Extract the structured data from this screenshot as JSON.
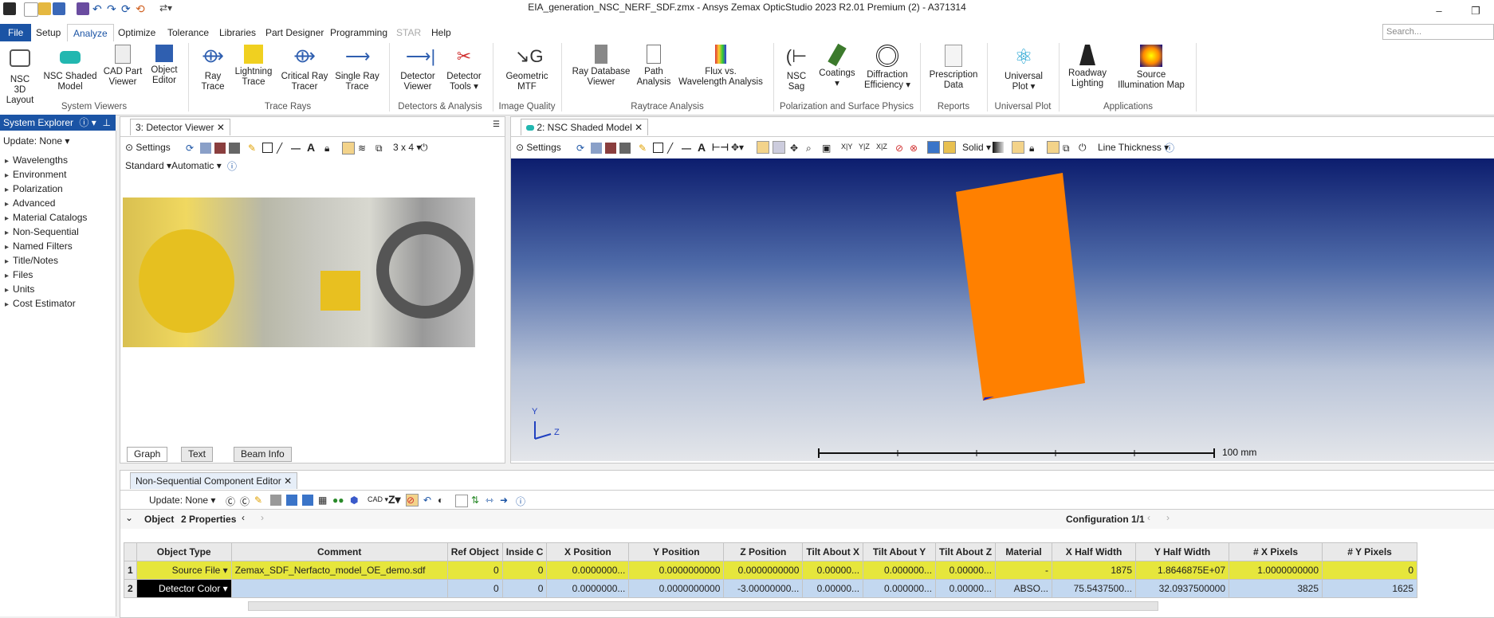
{
  "window": {
    "title": "EIA_generation_NSC_NERF_SDF.zmx - Ansys Zemax OpticStudio 2023 R2.01   Premium (2) - A371314"
  },
  "menu": {
    "items": [
      "File",
      "Setup",
      "Analyze",
      "Optimize",
      "Tolerance",
      "Libraries",
      "Part Designer",
      "Programming",
      "STAR",
      "Help"
    ],
    "search_placeholder": "Search..."
  },
  "ribbon": {
    "buttons": [
      {
        "l1": "NSC 3D",
        "l2": "Layout"
      },
      {
        "l1": "NSC Shaded",
        "l2": "Model"
      },
      {
        "l1": "CAD Part",
        "l2": "Viewer"
      },
      {
        "l1": "Object",
        "l2": "Editor"
      },
      {
        "l1": "Ray",
        "l2": "Trace"
      },
      {
        "l1": "Lightning",
        "l2": "Trace"
      },
      {
        "l1": "Critical Ray",
        "l2": "Tracer"
      },
      {
        "l1": "Single Ray",
        "l2": "Trace"
      },
      {
        "l1": "Detector",
        "l2": "Viewer"
      },
      {
        "l1": "Detector",
        "l2": "Tools ▾"
      },
      {
        "l1": "Geometric",
        "l2": "MTF"
      },
      {
        "l1": "Ray Database",
        "l2": "Viewer"
      },
      {
        "l1": "Path",
        "l2": "Analysis"
      },
      {
        "l1": "Flux vs.",
        "l2": "Wavelength Analysis"
      },
      {
        "l1": "NSC",
        "l2": "Sag"
      },
      {
        "l1": "Coatings",
        "l2": "▾"
      },
      {
        "l1": "Diffraction",
        "l2": "Efficiency ▾"
      },
      {
        "l1": "Prescription",
        "l2": "Data"
      },
      {
        "l1": "Universal",
        "l2": "Plot ▾"
      },
      {
        "l1": "Roadway",
        "l2": "Lighting"
      },
      {
        "l1": "Source",
        "l2": "Illumination Map"
      }
    ],
    "groups": [
      "System Viewers",
      "Trace Rays",
      "Detectors & Analysis",
      "Image Quality",
      "Raytrace Analysis",
      "Polarization and Surface Physics",
      "Reports",
      "Universal Plot",
      "Applications"
    ]
  },
  "system_explorer": {
    "title": "System Explorer",
    "update": "Update: None ▾",
    "items": [
      "Wavelengths",
      "Environment",
      "Polarization",
      "Advanced",
      "Material Catalogs",
      "Non-Sequential",
      "Named Filters",
      "Title/Notes",
      "Files",
      "Units",
      "Cost Estimator"
    ]
  },
  "detector_viewer": {
    "tab": "3: Detector Viewer",
    "settings": "Settings",
    "grid_label": "3 x 4 ▾",
    "standard": "Standard ▾",
    "automatic": "Automatic ▾",
    "bottom_tabs": [
      "Graph",
      "Text",
      "Beam Info"
    ]
  },
  "shaded_model": {
    "tab": "2: NSC Shaded Model",
    "settings": "Settings",
    "solid": "Solid ▾",
    "line_thickness": "Line Thickness ▾",
    "scale_label": "100 mm",
    "axis_y": "Y",
    "axis_z": "Z"
  },
  "editor": {
    "tab": "Non-Sequential Component Editor",
    "update": "Update: None ▾",
    "cad": "CAD ▾",
    "object_label": "Object",
    "properties": "2 Properties",
    "configuration": "Configuration 1/1",
    "columns": [
      "Object Type",
      "Comment",
      "Ref Object",
      "Inside C",
      "X Position",
      "Y Position",
      "Z Position",
      "Tilt About X",
      "Tilt About Y",
      "Tilt About Z",
      "Material",
      "X Half Width",
      "Y Half Width",
      "# X Pixels",
      "# Y Pixels"
    ],
    "rows": [
      {
        "num": "1",
        "type": "Source File ▾",
        "cells": [
          "Zemax_SDF_Nerfacto_model_OE_demo.sdf",
          "0",
          "0",
          "0.0000000...",
          "0.0000000000",
          "0.0000000000",
          "0.00000...",
          "0.000000...",
          "0.00000...",
          "-",
          "1875",
          "1.8646875E+07",
          "1.0000000000",
          "0"
        ]
      },
      {
        "num": "2",
        "type": "Detector Color ▾",
        "cells": [
          "",
          "0",
          "0",
          "0.0000000...",
          "0.0000000000",
          "-3.00000000...",
          "0.00000...",
          "0.000000...",
          "0.00000...",
          "ABSO...",
          "75.5437500...",
          "32.0937500000",
          "3825",
          "1625"
        ]
      }
    ]
  },
  "colors": {
    "accent": "#1b54a5",
    "row1": "#e6e63c",
    "row2": "#c3d8f0",
    "object": "#ff8000"
  }
}
